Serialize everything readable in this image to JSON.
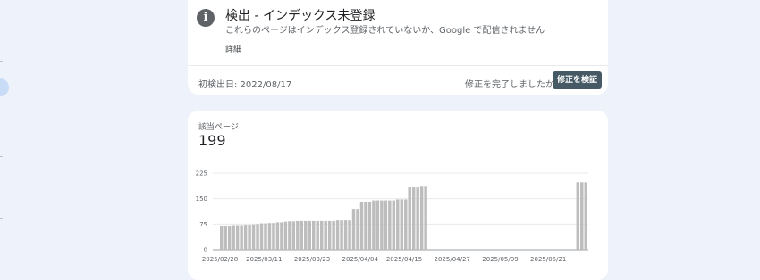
{
  "issue": {
    "title": "検出 - インデックス未登録",
    "description": "これらのページはインデックス登録されていないか、Google で配信されません",
    "details_link": "詳細",
    "first_detected": "初検出日: 2022/08/17",
    "fix_question": "修正を完了しましたか？",
    "validate_button": "修正を検証",
    "icon": "info-icon"
  },
  "pages": {
    "label": "該当ページ",
    "count": "199"
  },
  "colors": {
    "bar": "#bdbdbd",
    "accent_button": "#455a64",
    "background": "#eef3fb"
  },
  "chart_data": {
    "type": "bar",
    "ylim": [
      0,
      225
    ],
    "yticks": [
      0,
      75,
      150,
      225
    ],
    "x_tick_labels": [
      "2025/02/28",
      "2025/03/11",
      "2025/03/23",
      "2025/04/04",
      "2025/04/15",
      "2025/04/27",
      "2025/05/09",
      "2025/05/21"
    ],
    "x_tick_indices": [
      0,
      11,
      23,
      35,
      46,
      58,
      70,
      82
    ],
    "values": [
      68,
      68,
      68,
      72,
      72,
      72,
      73,
      73,
      74,
      75,
      77,
      77,
      78,
      78,
      80,
      80,
      82,
      83,
      83,
      84,
      84,
      84,
      84,
      84,
      84,
      84,
      84,
      84,
      84,
      86,
      86,
      86,
      86,
      120,
      120,
      140,
      140,
      140,
      145,
      145,
      145,
      145,
      145,
      145,
      148,
      148,
      148,
      183,
      183,
      183,
      185,
      185,
      0,
      0,
      0,
      0,
      0,
      0,
      0,
      0,
      0,
      0,
      0,
      0,
      0,
      0,
      0,
      0,
      0,
      0,
      0,
      0,
      0,
      0,
      0,
      0,
      0,
      0,
      0,
      0,
      0,
      0,
      0,
      0,
      0,
      0,
      0,
      0,
      0,
      198,
      198,
      198
    ],
    "grid": true
  }
}
